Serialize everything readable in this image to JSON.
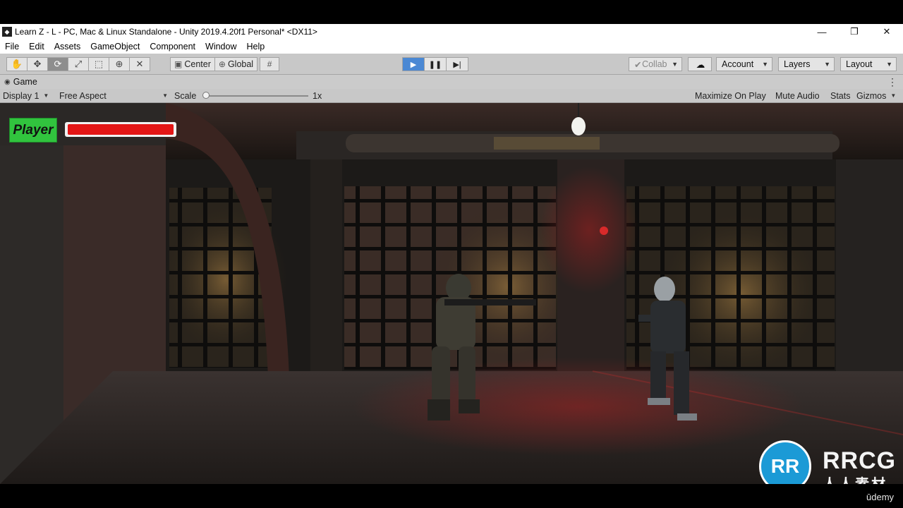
{
  "window": {
    "title": "Learn Z - L - PC, Mac & Linux Standalone - Unity 2019.4.20f1 Personal* <DX11>",
    "controls": {
      "minimize": "—",
      "maximize": "❐",
      "close": "✕"
    }
  },
  "menu": [
    "File",
    "Edit",
    "Assets",
    "GameObject",
    "Component",
    "Window",
    "Help"
  ],
  "toolbar": {
    "tools": [
      "hand-icon",
      "move-icon",
      "rotate-icon",
      "scale-icon",
      "rect-icon",
      "transform-icon",
      "custom-tool-icon"
    ],
    "active_tool": "rotate-icon",
    "pivot_label": "Center",
    "space_label": "Global",
    "collab_label": "Collab",
    "account_label": "Account",
    "layers_label": "Layers",
    "layout_label": "Layout",
    "play_state": "playing"
  },
  "game_view": {
    "tab_label": "Game",
    "display_label": "Display 1",
    "aspect_label": "Free Aspect",
    "scale_label": "Scale",
    "scale_value": "1x",
    "maximize_on_play": "Maximize On Play",
    "mute_audio": "Mute Audio",
    "stats": "Stats",
    "gizmos": "Gizmos"
  },
  "hud": {
    "player_label": "Player",
    "health_fraction": 1.0,
    "health_color": "#e31616"
  },
  "watermark": {
    "logo_text": "RR",
    "text": "RRCG",
    "subtext": "人人素材"
  },
  "footer": {
    "brand": "ūdemy"
  },
  "colors": {
    "play_active": "#4a88d4",
    "player_badge": "#31c43e"
  }
}
